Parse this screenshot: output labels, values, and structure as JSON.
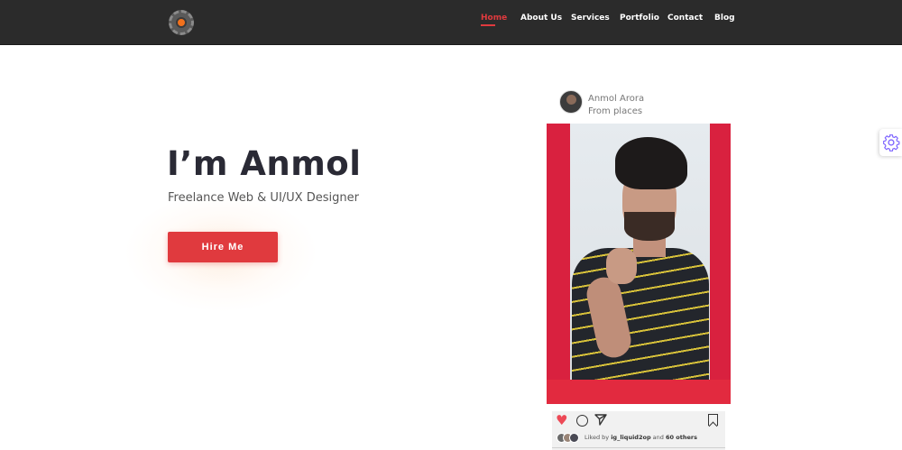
{
  "header": {
    "nav": [
      {
        "label": "Home",
        "active": true
      },
      {
        "label": "About Us",
        "active": false
      },
      {
        "label": "Services",
        "active": false
      },
      {
        "label": "Portfolio",
        "active": false
      },
      {
        "label": "Contact",
        "active": false
      },
      {
        "label": "Blog",
        "active": false
      }
    ],
    "logo_icon": "camera-aperture-logo-icon"
  },
  "hero": {
    "title": "I’m Anmol",
    "subtitle": "Freelance Web & UI/UX Designer",
    "cta_label": "Hire Me"
  },
  "instagram_card": {
    "user_name": "Anmol Arora",
    "location": "From places",
    "liked_prefix": "Liked by ",
    "liked_user": "ig_liquid2op",
    "liked_mid": " and ",
    "liked_others": "60 others",
    "icons": [
      "heart-icon",
      "comment-icon",
      "share-icon",
      "bookmark-icon"
    ]
  },
  "settings": {
    "icon": "gear-icon"
  },
  "colors": {
    "accent": "#e03a3e",
    "header_bg": "#2b2b2b",
    "photo_bg": "#d9213f",
    "gear": "#7b61ff"
  }
}
